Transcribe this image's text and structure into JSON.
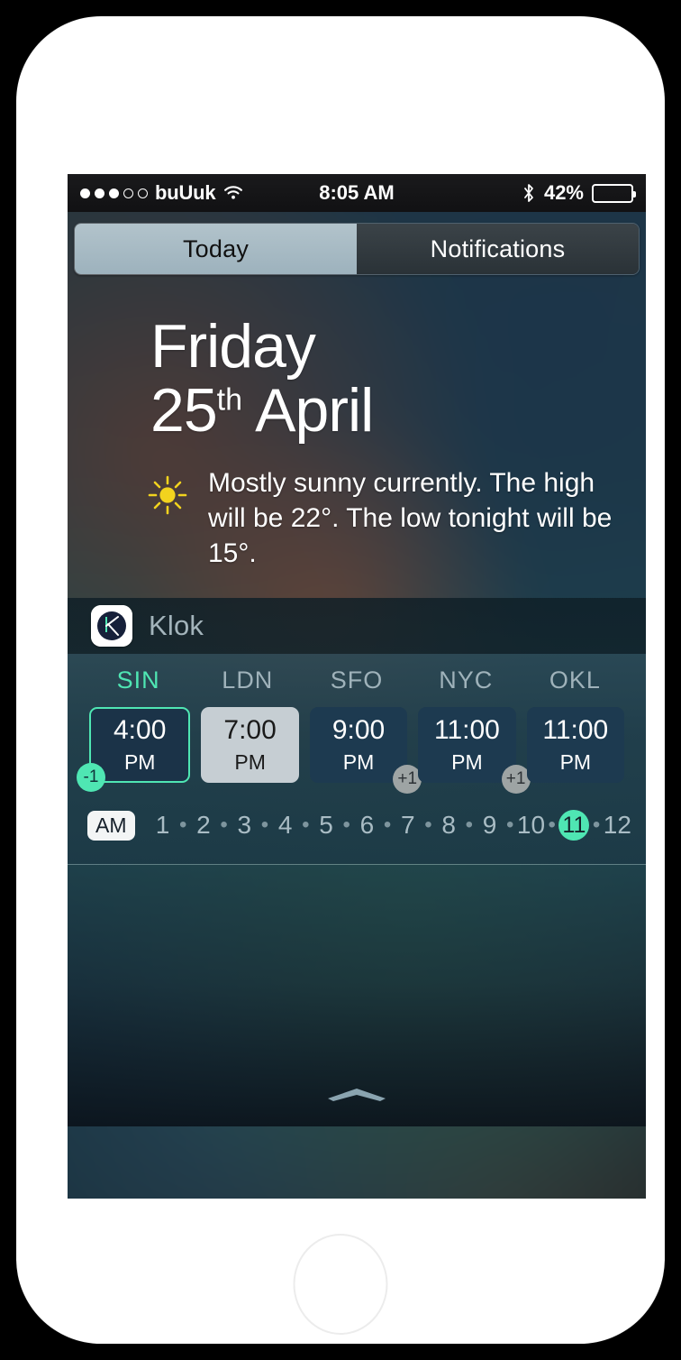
{
  "device": {
    "name": "iphone-white"
  },
  "status_bar": {
    "signal_dots_filled": 3,
    "signal_dots_total": 5,
    "carrier": "buUuk",
    "wifi_icon": "wifi-icon",
    "time": "8:05 AM",
    "bluetooth_icon": "bluetooth-icon",
    "battery_percent": "42%",
    "battery_level": 42
  },
  "tabs": [
    {
      "label": "Today",
      "active": true
    },
    {
      "label": "Notifications",
      "active": false
    }
  ],
  "today": {
    "day_name": "Friday",
    "day_number": "25",
    "day_suffix": "th",
    "month": "April",
    "weather_icon": "sun-icon",
    "weather_summary": "Mostly sunny currently. The high will be 22°. The low tonight will be 15°."
  },
  "widget": {
    "app_icon": "klok-app-icon",
    "title": "Klok",
    "cities": [
      {
        "code": "SIN",
        "time": "4:00",
        "ampm": "PM",
        "offset_badge": "-1",
        "badge_type": "neg",
        "selected": true,
        "style": "dark"
      },
      {
        "code": "LDN",
        "time": "7:00",
        "ampm": "PM",
        "offset_badge": "",
        "badge_type": "",
        "selected": false,
        "style": "light"
      },
      {
        "code": "SFO",
        "time": "9:00",
        "ampm": "PM",
        "offset_badge": "+1",
        "badge_type": "pos",
        "selected": false,
        "style": "dark"
      },
      {
        "code": "NYC",
        "time": "11:00",
        "ampm": "PM",
        "offset_badge": "+1",
        "badge_type": "pos",
        "selected": false,
        "style": "dark"
      },
      {
        "code": "OKL",
        "time": "11:00",
        "ampm": "PM",
        "offset_badge": "",
        "badge_type": "",
        "selected": false,
        "style": "dark"
      }
    ],
    "hour_strip": {
      "meridiem_label": "AM",
      "hours": [
        "1",
        "2",
        "3",
        "4",
        "5",
        "6",
        "7",
        "8",
        "9",
        "10",
        "11",
        "12"
      ],
      "selected_hour": "11",
      "separator_glyph": "•"
    }
  },
  "footer": {
    "grabber_icon": "chevron-up-grabber"
  },
  "colors": {
    "accent_teal": "#4fe6b3",
    "card_dark": "#1d3a50",
    "card_light": "#c6ced3",
    "badge_gray": "#9ea4a4",
    "city_inactive": "#9fb2ba",
    "widget_title": "#a3b4bb",
    "sun_yellow": "#f2d31e"
  }
}
